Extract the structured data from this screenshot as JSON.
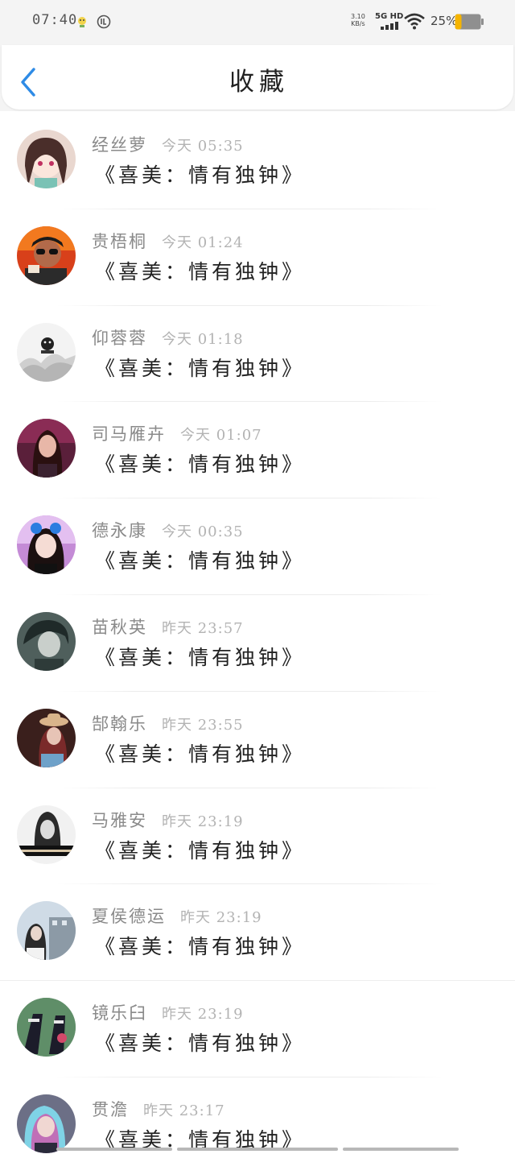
{
  "status_bar": {
    "time": "07:40",
    "net_speed_value": "3.10",
    "net_speed_unit": "KB/s",
    "network_type": "5G HD",
    "battery_percent": "25%",
    "battery_level": 0.25,
    "battery_color": "#f5b400"
  },
  "header": {
    "title": "收藏"
  },
  "accent_color": "#2e8be6",
  "items": [
    {
      "name": "经丝萝",
      "time": "今天 05:35",
      "content": "《喜美：情有独钟》"
    },
    {
      "name": "贵梧桐",
      "time": "今天 01:24",
      "content": "《喜美：情有独钟》"
    },
    {
      "name": "仰蓉蓉",
      "time": "今天 01:18",
      "content": "《喜美：情有独钟》"
    },
    {
      "name": "司马雁卉",
      "time": "今天 01:07",
      "content": "《喜美：情有独钟》"
    },
    {
      "name": "德永康",
      "time": "今天 00:35",
      "content": "《喜美：情有独钟》"
    },
    {
      "name": "苗秋英",
      "time": "昨天 23:57",
      "content": "《喜美：情有独钟》"
    },
    {
      "name": "郜翰乐",
      "time": "昨天 23:55",
      "content": "《喜美：情有独钟》"
    },
    {
      "name": "马雅安",
      "time": "昨天 23:19",
      "content": "《喜美：情有独钟》"
    },
    {
      "name": "夏侯德运",
      "time": "昨天 23:19",
      "content": "《喜美：情有独钟》"
    },
    {
      "name": "镜乐臼",
      "time": "昨天 23:19",
      "content": "《喜美：情有独钟》"
    },
    {
      "name": "贯澹",
      "time": "昨天 23:17",
      "content": "《喜美：情有独钟》"
    }
  ]
}
